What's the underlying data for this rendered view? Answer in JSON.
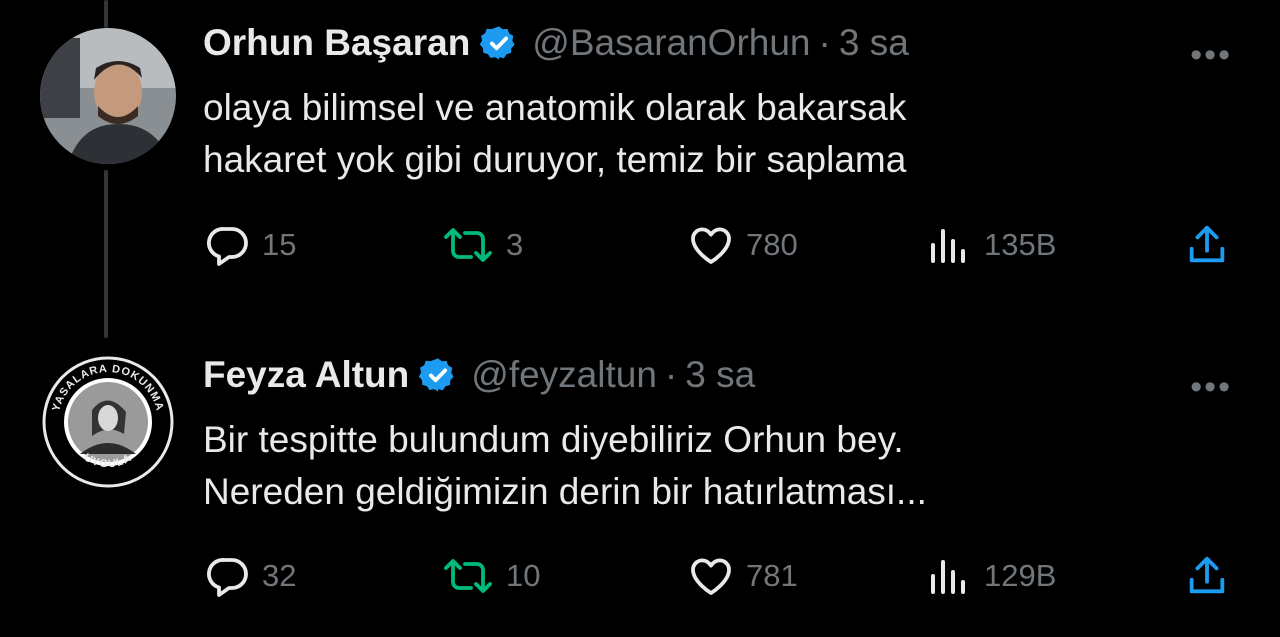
{
  "tweets": [
    {
      "name": "Orhun Başaran",
      "handle": "@BasaranOrhun",
      "separator": "·",
      "time": "3 sa",
      "more": "•••",
      "lines": [
        "olaya bilimsel ve anatomik olarak bakarsak",
        "hakaret yok gibi duruyor, temiz bir saplama"
      ],
      "replies": "15",
      "retweets": "3",
      "likes": "780",
      "views": "135B"
    },
    {
      "name": "Feyza Altun",
      "handle": "@feyzaltun",
      "separator": "·",
      "time": "3 sa",
      "more": "•••",
      "avatar_badge_top": "YASALARA DOKUNMA",
      "avatar_badge_bottom": "UYGULA",
      "lines": [
        "Bir tespitte bulundum diyebiliriz Orhun bey.",
        "Nereden geldiğimizin derin bir hatırlatması..."
      ],
      "replies": "32",
      "retweets": "10",
      "likes": "781",
      "views": "129B"
    }
  ],
  "colors": {
    "background": "#000000",
    "text": "#e7e9ea",
    "muted": "#71767b",
    "verified": "#1d9bf0",
    "thread_line": "#333639"
  }
}
